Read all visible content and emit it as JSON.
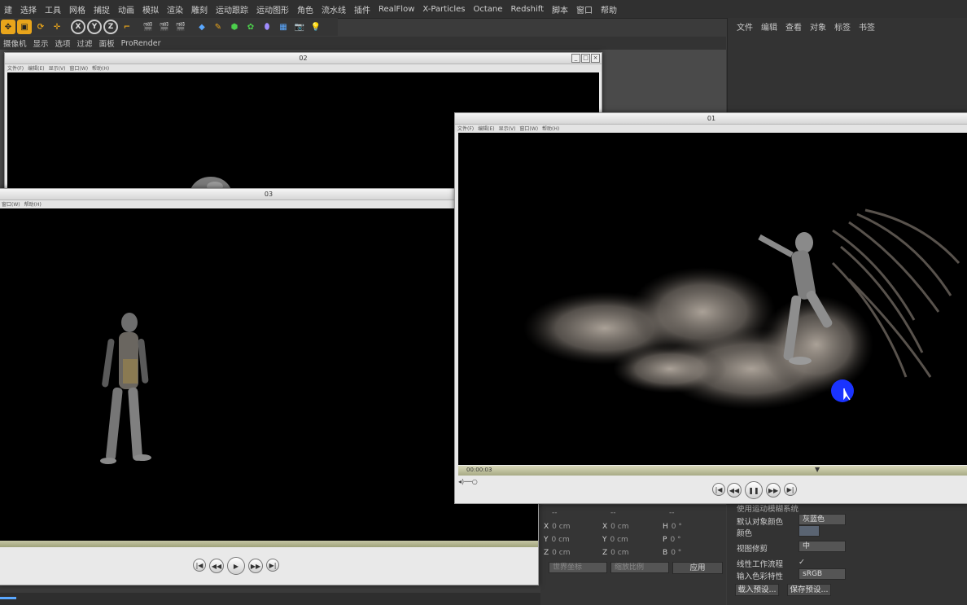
{
  "menubar": [
    "建",
    "选择",
    "工具",
    "网格",
    "捕捉",
    "动画",
    "模拟",
    "渲染",
    "雕刻",
    "运动跟踪",
    "运动图形",
    "角色",
    "流水线",
    "插件",
    "RealFlow",
    "X-Particles",
    "Octane",
    "Redshift",
    "脚本",
    "窗口",
    "帮助"
  ],
  "toolbar": {
    "axis_x": "X",
    "axis_y": "Y",
    "axis_z": "Z"
  },
  "viewport_menu": [
    "摄像机",
    "显示",
    "选项",
    "过滤",
    "面板",
    "ProRender"
  ],
  "right_menu": [
    "文件",
    "编辑",
    "查看",
    "对象",
    "标签",
    "书签"
  ],
  "windows": {
    "win02": {
      "title": "02",
      "menu": [
        "文件(F)",
        "编辑(E)",
        "显示(V)",
        "窗口(W)",
        "帮助(H)"
      ]
    },
    "win03": {
      "title": "03",
      "menu": [
        "窗口(W)",
        "帮助(H)"
      ]
    },
    "win01": {
      "title": "01",
      "menu": [
        "文件(F)",
        "编辑(E)",
        "显示(V)",
        "窗口(W)",
        "帮助(H)"
      ],
      "timecode": "00:00:03"
    }
  },
  "coords": {
    "headers": [
      "--",
      "--",
      "--"
    ],
    "rows": [
      {
        "a": "X",
        "av": "0 cm",
        "b": "X",
        "bv": "0 cm",
        "c": "H",
        "cv": "0 °"
      },
      {
        "a": "Y",
        "av": "0 cm",
        "b": "Y",
        "bv": "0 cm",
        "c": "P",
        "cv": "0 °"
      },
      {
        "a": "Z",
        "av": "0 cm",
        "b": "Z",
        "bv": "0 cm",
        "c": "B",
        "cv": "0 °"
      }
    ],
    "world_dropdown": "世界坐标",
    "scale_dropdown": "缩放比例",
    "apply": "应用"
  },
  "attributes": {
    "motion_blur": "使用运动模糊系统",
    "default_color_label": "默认对象颜色",
    "default_color_value": "灰蓝色",
    "color_label": "颜色",
    "view_clip_label": "视图修剪",
    "view_clip_value": "中",
    "linear_label": "线性工作流程",
    "linear_value": "✓",
    "input_color_label": "输入色彩特性",
    "input_color_value": "sRGB",
    "load_preset": "载入预设...",
    "save_preset": "保存预设..."
  },
  "colors": {
    "accent": "#e9a51b",
    "cursor": "#1a33ff"
  }
}
